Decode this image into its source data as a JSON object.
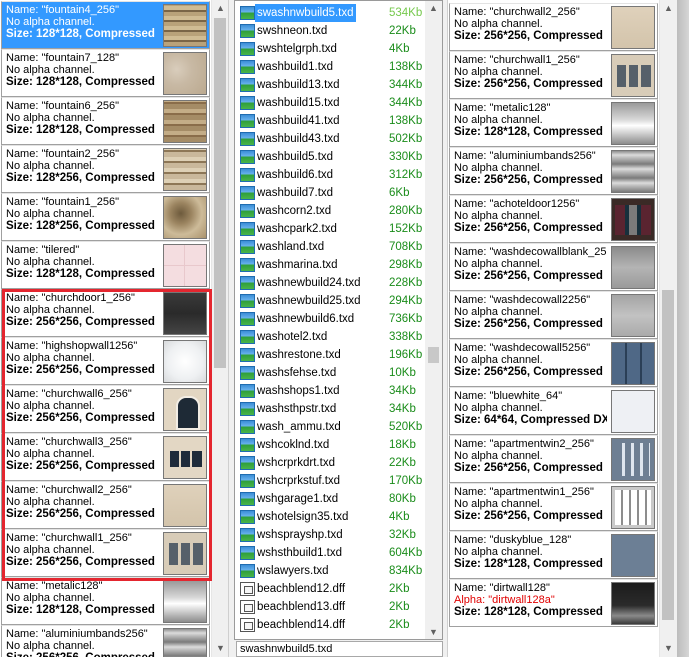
{
  "left_pane": {
    "items": [
      {
        "name": "Name: \"fountain4_256\"",
        "alpha": "No alpha channel.",
        "size": "Size: 128*128, Compressed",
        "thumb": "fountain4",
        "selected": true
      },
      {
        "name": "Name: \"fountain7_128\"",
        "alpha": "No alpha channel.",
        "size": "Size: 128*128, Compressed",
        "thumb": "fountain7"
      },
      {
        "name": "Name: \"fountain6_256\"",
        "alpha": "No alpha channel.",
        "size": "Size: 128*128, Compressed",
        "thumb": "fountain6"
      },
      {
        "name": "Name: \"fountain2_256\"",
        "alpha": "No alpha channel.",
        "size": "Size: 128*256, Compressed",
        "thumb": "fountain2"
      },
      {
        "name": "Name: \"fountain1_256\"",
        "alpha": "No alpha channel.",
        "size": "Size: 128*256, Compressed",
        "thumb": "fountain1"
      },
      {
        "name": "Name: \"tilered\"",
        "alpha": "No alpha channel.",
        "size": "Size: 128*128, Compressed",
        "thumb": "tilered"
      },
      {
        "name": "Name: \"churchdoor1_256\"",
        "alpha": "No alpha channel.",
        "size": "Size: 256*256, Compressed",
        "thumb": "churchdoor"
      },
      {
        "name": "Name: \"highshopwall1256\"",
        "alpha": "No alpha channel.",
        "size": "Size: 256*256, Compressed",
        "thumb": "highshop"
      },
      {
        "name": "Name: \"churchwall6_256\"",
        "alpha": "No alpha channel.",
        "size": "Size: 256*256, Compressed",
        "thumb": "churchwall6"
      },
      {
        "name": "Name: \"churchwall3_256\"",
        "alpha": "No alpha channel.",
        "size": "Size: 256*256, Compressed",
        "thumb": "window3"
      },
      {
        "name": "Name: \"churchwall2_256\"",
        "alpha": "No alpha channel.",
        "size": "Size: 256*256, Compressed",
        "thumb": "churchwall2"
      },
      {
        "name": "Name: \"churchwall1_256\"",
        "alpha": "No alpha channel.",
        "size": "Size: 256*256, Compressed",
        "thumb": "churchwall1"
      },
      {
        "name": "Name: \"metalic128\"",
        "alpha": "No alpha channel.",
        "size": "Size: 128*128, Compressed",
        "thumb": "metalic"
      },
      {
        "name": "Name: \"aluminiumbands256\"",
        "alpha": "No alpha channel.",
        "size": "Size: 256*256, Compressed",
        "thumb": "aluminium"
      }
    ]
  },
  "file_list": {
    "files": [
      {
        "name": "swashnwbuild5.txd",
        "size": "534Kb",
        "icon": "image-icon",
        "selected": true
      },
      {
        "name": "swshneon.txd",
        "size": "22Kb",
        "icon": "image-icon"
      },
      {
        "name": "swshtelgrph.txd",
        "size": "4Kb",
        "icon": "image-icon"
      },
      {
        "name": "washbuild1.txd",
        "size": "138Kb",
        "icon": "image-icon"
      },
      {
        "name": "washbuild13.txd",
        "size": "344Kb",
        "icon": "image-icon"
      },
      {
        "name": "washbuild15.txd",
        "size": "344Kb",
        "icon": "image-icon"
      },
      {
        "name": "washbuild41.txd",
        "size": "138Kb",
        "icon": "image-icon"
      },
      {
        "name": "washbuild43.txd",
        "size": "502Kb",
        "icon": "image-icon"
      },
      {
        "name": "washbuild5.txd",
        "size": "330Kb",
        "icon": "image-icon"
      },
      {
        "name": "washbuild6.txd",
        "size": "312Kb",
        "icon": "image-icon"
      },
      {
        "name": "washbuild7.txd",
        "size": "6Kb",
        "icon": "image-icon"
      },
      {
        "name": "washcorn2.txd",
        "size": "280Kb",
        "icon": "image-icon"
      },
      {
        "name": "washcpark2.txd",
        "size": "152Kb",
        "icon": "image-icon"
      },
      {
        "name": "washland.txd",
        "size": "708Kb",
        "icon": "image-icon"
      },
      {
        "name": "washmarina.txd",
        "size": "298Kb",
        "icon": "image-icon"
      },
      {
        "name": "washnewbuild24.txd",
        "size": "228Kb",
        "icon": "image-icon"
      },
      {
        "name": "washnewbuild25.txd",
        "size": "294Kb",
        "icon": "image-icon"
      },
      {
        "name": "washnewbuild6.txd",
        "size": "736Kb",
        "icon": "image-icon"
      },
      {
        "name": "washotel2.txd",
        "size": "338Kb",
        "icon": "image-icon"
      },
      {
        "name": "washrestone.txd",
        "size": "196Kb",
        "icon": "image-icon"
      },
      {
        "name": "washsfehse.txd",
        "size": "10Kb",
        "icon": "image-icon"
      },
      {
        "name": "washshops1.txd",
        "size": "34Kb",
        "icon": "image-icon"
      },
      {
        "name": "washsthpstr.txd",
        "size": "34Kb",
        "icon": "image-icon"
      },
      {
        "name": "wash_ammu.txd",
        "size": "520Kb",
        "icon": "image-icon"
      },
      {
        "name": "wshcoklnd.txd",
        "size": "18Kb",
        "icon": "image-icon"
      },
      {
        "name": "wshcrprkdrt.txd",
        "size": "22Kb",
        "icon": "image-icon"
      },
      {
        "name": "wshcrprkstuf.txd",
        "size": "170Kb",
        "icon": "image-icon"
      },
      {
        "name": "wshgarage1.txd",
        "size": "80Kb",
        "icon": "image-icon"
      },
      {
        "name": "wshotelsign35.txd",
        "size": "4Kb",
        "icon": "image-icon"
      },
      {
        "name": "wshsprayshp.txd",
        "size": "32Kb",
        "icon": "image-icon"
      },
      {
        "name": "wshsthbuild1.txd",
        "size": "604Kb",
        "icon": "image-icon"
      },
      {
        "name": "wslawyers.txd",
        "size": "834Kb",
        "icon": "image-icon"
      },
      {
        "name": "beachblend12.dff",
        "size": "2Kb",
        "icon": "model-file-icon"
      },
      {
        "name": "beachblend13.dff",
        "size": "2Kb",
        "icon": "model-file-icon"
      },
      {
        "name": "beachblend14.dff",
        "size": "2Kb",
        "icon": "model-file-icon"
      }
    ],
    "current_file": "swashnwbuild5.txd"
  },
  "right_pane": {
    "items": [
      {
        "name": "Name: \"churchwall2_256\"",
        "alpha": "No alpha channel.",
        "size": "Size: 256*256, Compressed",
        "thumb": "churchwall2"
      },
      {
        "name": "Name: \"churchwall1_256\"",
        "alpha": "No alpha channel.",
        "size": "Size: 256*256, Compressed",
        "thumb": "churchwall1"
      },
      {
        "name": "Name: \"metalic128\"",
        "alpha": "No alpha channel.",
        "size": "Size: 128*128, Compressed",
        "thumb": "metalic"
      },
      {
        "name": "Name: \"aluminiumbands256\"",
        "alpha": "No alpha channel.",
        "size": "Size: 256*256, Compressed",
        "thumb": "aluminium"
      },
      {
        "name": "Name: \"achoteldoor1256\"",
        "alpha": "No alpha channel.",
        "size": "Size: 256*256, Compressed",
        "thumb": "achotel"
      },
      {
        "name": "Name: \"washdecowallblank_256\"",
        "alpha": "No alpha channel.",
        "size": "Size: 256*256, Compressed",
        "thumb": "washdecoblank"
      },
      {
        "name": "Name: \"washdecowall2256\"",
        "alpha": "No alpha channel.",
        "size": "Size: 256*256, Compressed",
        "thumb": "washdeco2256"
      },
      {
        "name": "Name: \"washdecowall5256\"",
        "alpha": "No alpha channel.",
        "size": "Size: 256*256, Compressed",
        "thumb": "washdeco5256"
      },
      {
        "name": "Name: \"bluewhite_64\"",
        "alpha": "No alpha channel.",
        "size": "Size: 64*64, Compressed DXT",
        "thumb": "bluewhite"
      },
      {
        "name": "Name: \"apartmentwin2_256\"",
        "alpha": "No alpha channel.",
        "size": "Size: 256*256, Compressed",
        "thumb": "apart2"
      },
      {
        "name": "Name: \"apartmentwin1_256\"",
        "alpha": "No alpha channel.",
        "size": "Size: 256*256, Compressed",
        "thumb": "apart1"
      },
      {
        "name": "Name: \"duskyblue_128\"",
        "alpha": "No alpha channel.",
        "size": "Size: 128*128, Compressed",
        "thumb": "duskyblue"
      },
      {
        "name": "Name: \"dirtwall128\"",
        "alpha": "Alpha: \"dirtwall128a\"",
        "size": "Size: 128*128, Compressed",
        "thumb": "dirtwall",
        "alpha_red": true
      }
    ]
  },
  "colors": {
    "selection_blue": "#3399ff",
    "highlight_red": "#e4262f",
    "file_size_green": "#1a8c1a",
    "alpha_text_red": "#e00000"
  },
  "icons": {
    "scroll_up": "▲",
    "scroll_down": "▼"
  }
}
